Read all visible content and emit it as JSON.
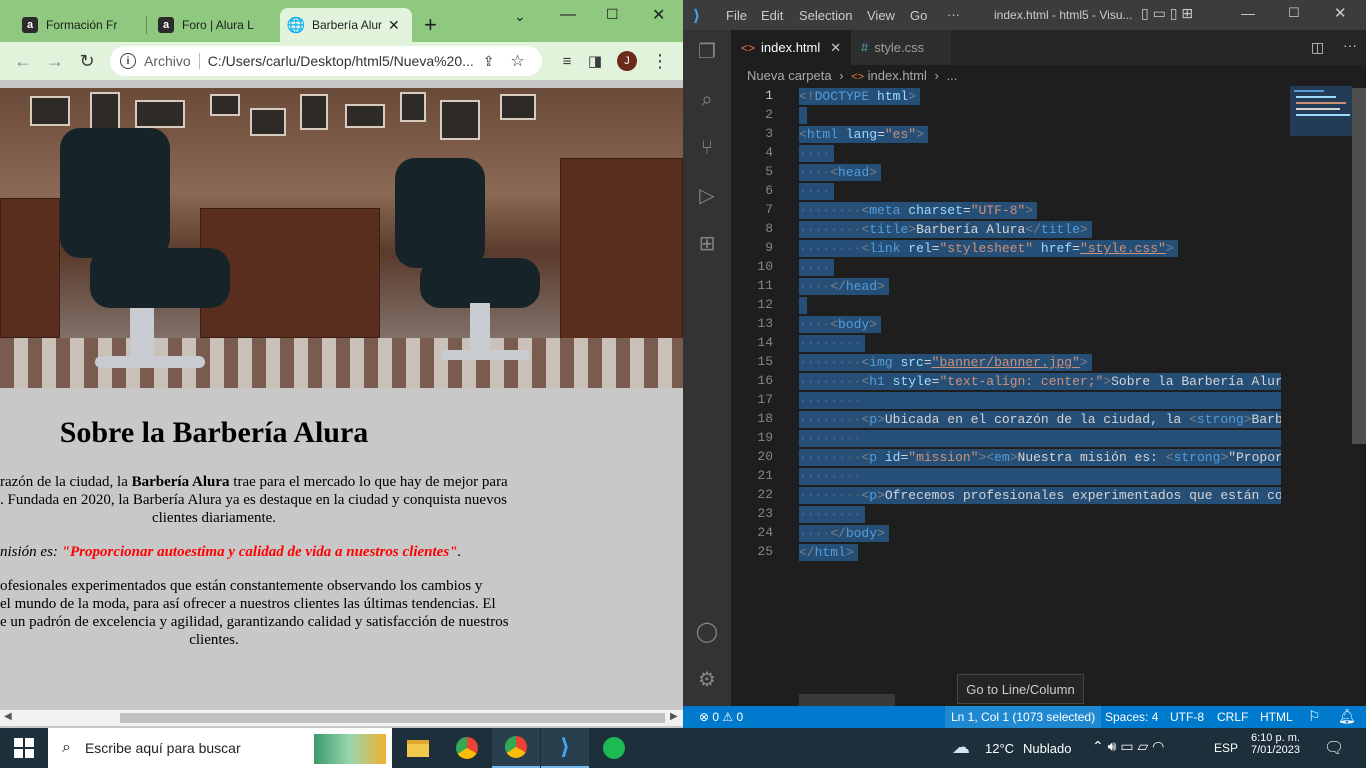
{
  "chrome": {
    "tabs": [
      {
        "title": "Formación Fr"
      },
      {
        "title": "Foro | Alura L"
      },
      {
        "title": "Barbería Alur"
      }
    ],
    "new_tab": "+",
    "address_label": "Archivo",
    "address_url": "C:/Users/carlu/Desktop/html5/Nueva%20...",
    "profile_initial": "J"
  },
  "page": {
    "heading": "Sobre la Barbería Alura",
    "p1_line1_a": "razón de la ciudad, la ",
    "p1_line1_strong": "Barbería Alura",
    "p1_line1_b": " trae para el mercado lo que hay de mejor para",
    "p1_line2": ". Fundada en 2020, la Barbería Alura ya es destaque en la ciudad y conquista nuevos",
    "p1_line3": "clientes diariamente.",
    "mission_prefix": "nisión es: ",
    "mission_strong": "\"Proporcionar autoestima y calidad de vida a nuestros clientes\"",
    "mission_end": ".",
    "p3_line1": "ofesionales experimentados que están constantemente observando los cambios y",
    "p3_line2": "el mundo de la moda, para así ofrecer a nuestros clientes las últimas tendencias. El",
    "p3_line3": "e un padrón de excelencia y agilidad, garantizando calidad y satisfacción de nuestros",
    "p3_line4": "clientes."
  },
  "vscode": {
    "menu": [
      "File",
      "Edit",
      "Selection",
      "View",
      "Go",
      "···"
    ],
    "title": "index.html - html5 - Visu...",
    "tabs": [
      {
        "label": "index.html",
        "icon": "<>"
      },
      {
        "label": "style.css",
        "icon": "#"
      }
    ],
    "breadcrumb": [
      "Nueva carpeta",
      "index.html",
      "..."
    ],
    "line_numbers": [
      "1",
      "2",
      "3",
      "4",
      "5",
      "6",
      "7",
      "8",
      "9",
      "10",
      "11",
      "12",
      "13",
      "14",
      "15",
      "16",
      "17",
      "18",
      "19",
      "20",
      "21",
      "22",
      "23",
      "24",
      "25"
    ],
    "tooltip": "Go to Line/Column",
    "status": {
      "problems": "⊗ 0 ⚠ 0",
      "position": "Ln 1, Col 1 (1073 selected)",
      "spaces": "Spaces: 4",
      "encoding": "UTF-8",
      "eol": "CRLF",
      "language": "HTML"
    }
  },
  "taskbar": {
    "search_placeholder": "Escribe aquí para buscar",
    "weather_temp": "12°C",
    "weather_text": "Nublado",
    "lang": "ESP",
    "time": "6:10 p. m.",
    "date": "7/01/2023"
  },
  "colors": {
    "chrome_frame": "#8fc97f",
    "vscode_status": "#007acc",
    "selection": "#264f78",
    "mission_red": "#ff0000"
  }
}
